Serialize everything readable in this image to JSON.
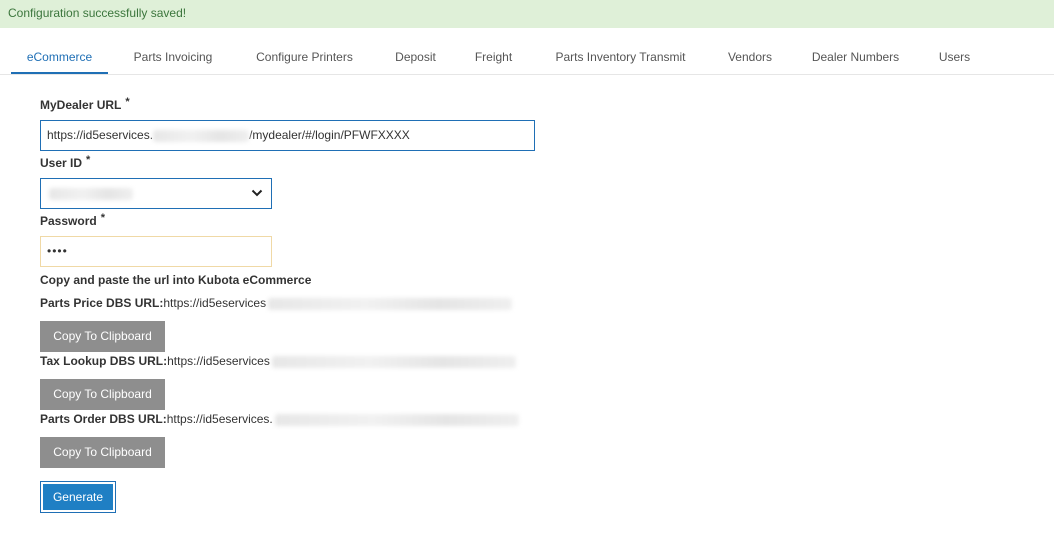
{
  "alert": {
    "message": "Configuration successfully saved!"
  },
  "tabs": [
    {
      "label": "eCommerce"
    },
    {
      "label": "Parts Invoicing"
    },
    {
      "label": "Configure Printers"
    },
    {
      "label": "Deposit"
    },
    {
      "label": "Freight"
    },
    {
      "label": "Parts Inventory Transmit"
    },
    {
      "label": "Vendors"
    },
    {
      "label": "Dealer Numbers"
    },
    {
      "label": "Users"
    }
  ],
  "active_tab": "eCommerce",
  "form": {
    "mydealer_url": {
      "label": "MyDealer URL",
      "required": "*",
      "value_prefix": "https://id5eservices.",
      "value_suffix": "/mydealer/#/login/PFWFXXXX"
    },
    "user_id": {
      "label": "User ID",
      "required": "*"
    },
    "password": {
      "label": "Password",
      "required": "*",
      "value": "••••"
    },
    "copy_heading": "Copy and paste the url into Kubota eCommerce",
    "urls": [
      {
        "label": "Parts Price DBS URL:",
        "value": "https://id5eservices"
      },
      {
        "label": "Tax Lookup DBS URL:",
        "value": "https://id5eservices"
      },
      {
        "label": "Parts Order DBS URL:",
        "value": "https://id5eservices."
      }
    ],
    "copy_button_label": "Copy To Clipboard",
    "generate_label": "Generate"
  },
  "colors": {
    "alert_bg": "#dff0d8",
    "alert_text": "#3c763d",
    "accent": "#1f6fb5",
    "button_gray": "#8e8e8e",
    "button_primary": "#1f7fc4"
  },
  "icons": {
    "select_caret": "chevron-down-icon"
  }
}
